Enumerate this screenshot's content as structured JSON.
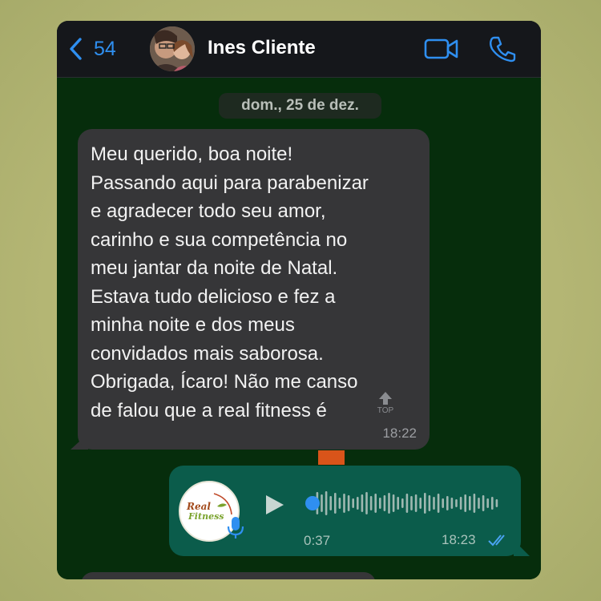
{
  "header": {
    "back_count": "54",
    "contact_name": "Ines Cliente"
  },
  "chat": {
    "date_label": "dom., 25 de dez.",
    "incoming": {
      "text": "Meu querido, boa noite!\nPassando aqui para parabenizar\ne agradecer todo seu amor,\ncarinho e sua competência no\nmeu jantar da noite de Natal.\nEstava tudo delicioso e fez a\nminha noite e dos meus\nconvidados mais saborosa.\nObrigada, Ícaro! Não me canso\nde falou que a real fitness é",
      "time": "18:22",
      "top_badge": "TOP"
    },
    "outgoing_audio": {
      "duration": "0:37",
      "time": "18:23",
      "sender_logo_line1": "Real",
      "sender_logo_line2": "Fitness",
      "progress": 0
    }
  },
  "colors": {
    "accent": "#2f8ff0",
    "chat_bg": "#062d0c",
    "incoming_bubble": "#363638",
    "outgoing_bubble": "#0b5c4b",
    "orange": "#d9541a"
  },
  "icons": {
    "back": "chevron-left-icon",
    "video": "video-camera-icon",
    "phone": "phone-icon",
    "play": "play-icon",
    "mic": "microphone-icon",
    "ticks": "double-check-icon"
  }
}
